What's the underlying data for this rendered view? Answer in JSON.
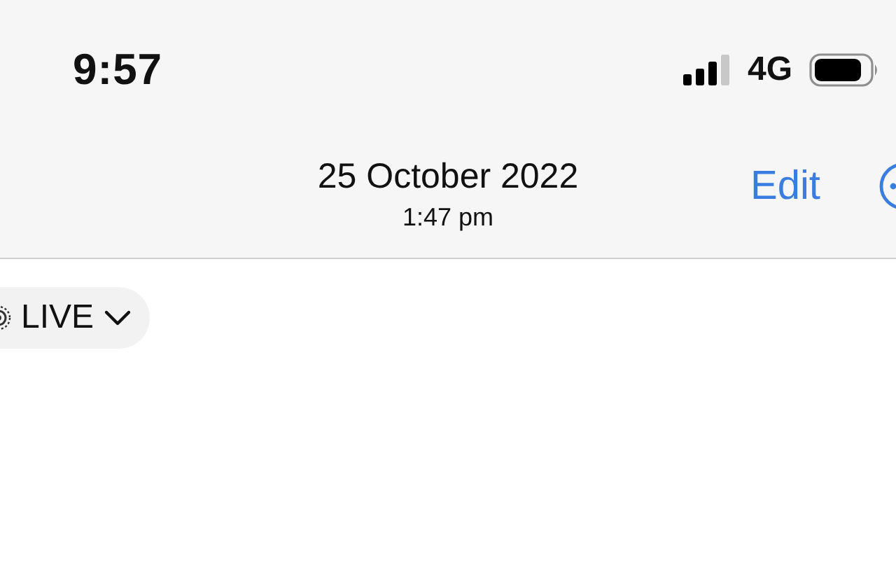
{
  "status_bar": {
    "time": "9:57",
    "network": "4G"
  },
  "nav_bar": {
    "title": "25 October 2022",
    "subtitle": "1:47 pm",
    "edit": "Edit"
  },
  "live_button": {
    "label": "LIVE"
  }
}
